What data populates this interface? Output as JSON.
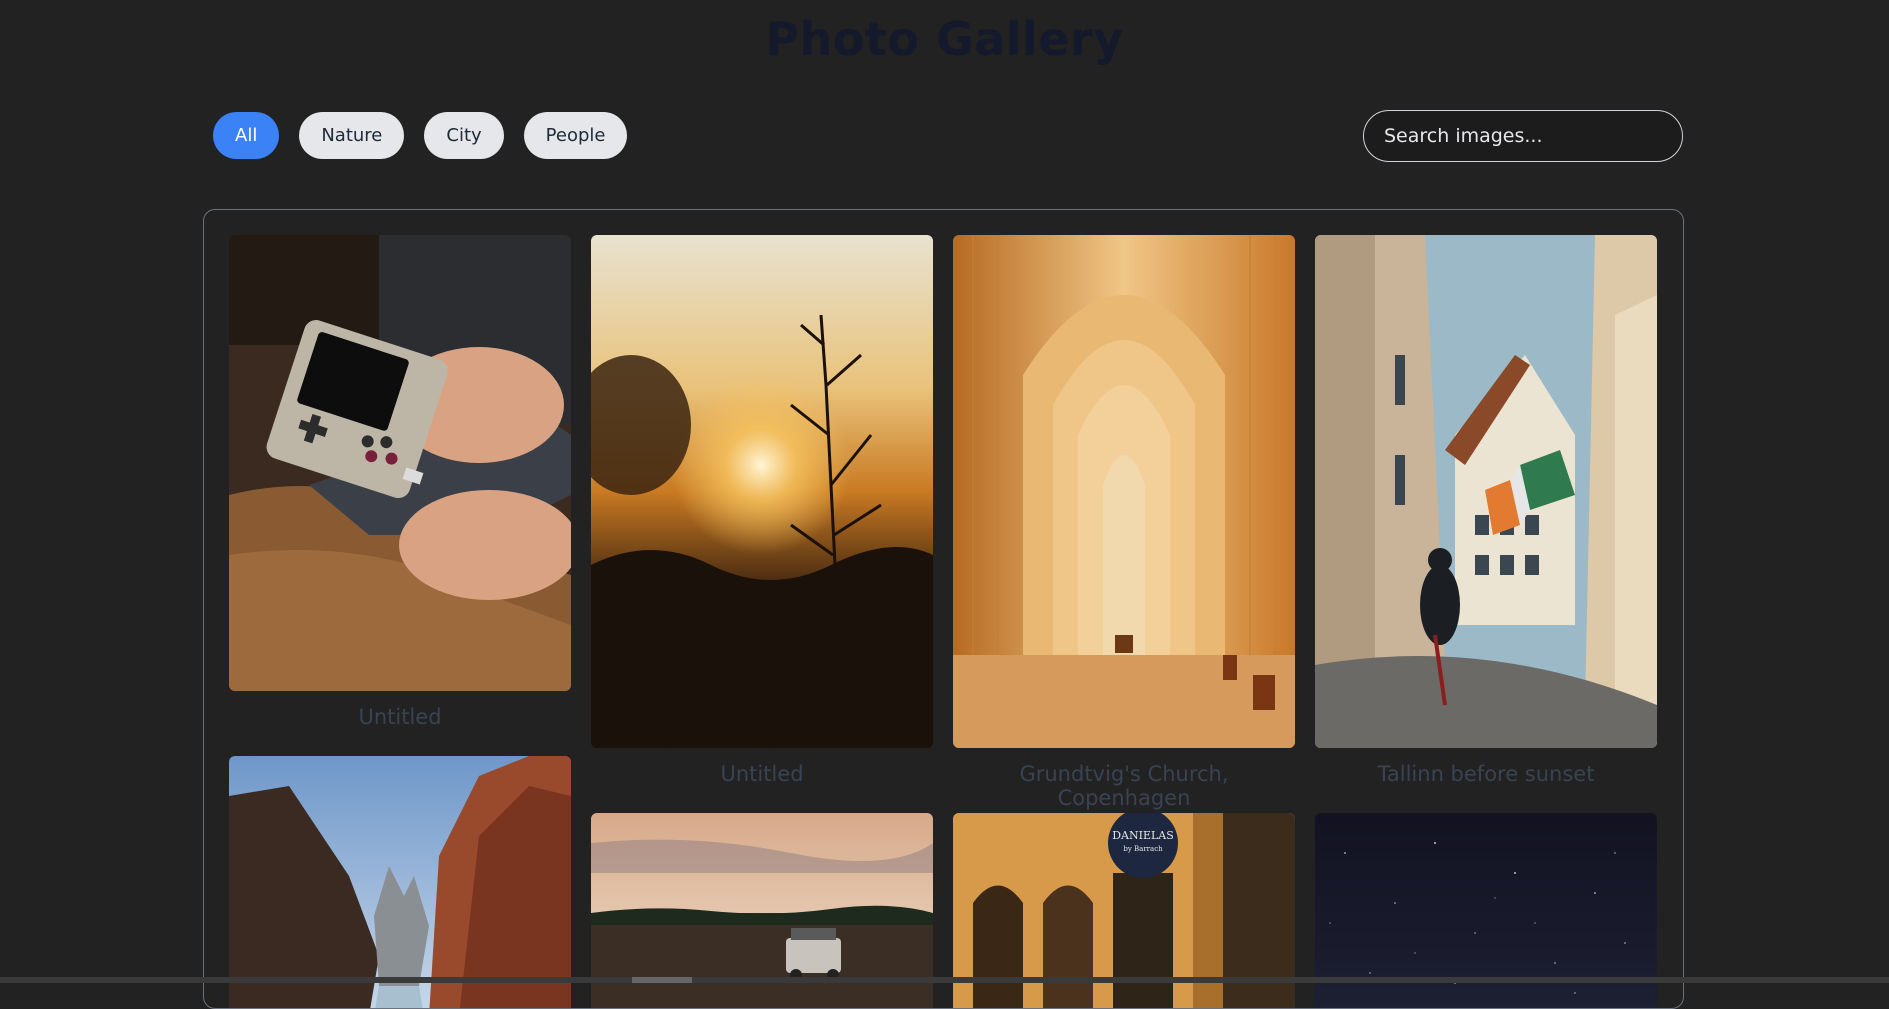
{
  "page": {
    "title": "Photo Gallery"
  },
  "filters": [
    {
      "label": "All",
      "active": true
    },
    {
      "label": "Nature",
      "active": false
    },
    {
      "label": "City",
      "active": false
    },
    {
      "label": "People",
      "active": false
    }
  ],
  "search": {
    "placeholder": "Search images...",
    "value": ""
  },
  "gallery": {
    "items": [
      {
        "caption": "Untitled"
      },
      {
        "caption": "Untitled"
      },
      {
        "caption": "Grundtvig's Church, Copenhagen"
      },
      {
        "caption": "Tallinn before sunset"
      },
      {
        "caption": ""
      },
      {
        "caption": ""
      },
      {
        "caption": ""
      },
      {
        "caption": ""
      }
    ]
  },
  "colors": {
    "background": "#222222",
    "accent": "#3b82f6",
    "title": "#14192b",
    "caption": "#3a4354"
  }
}
